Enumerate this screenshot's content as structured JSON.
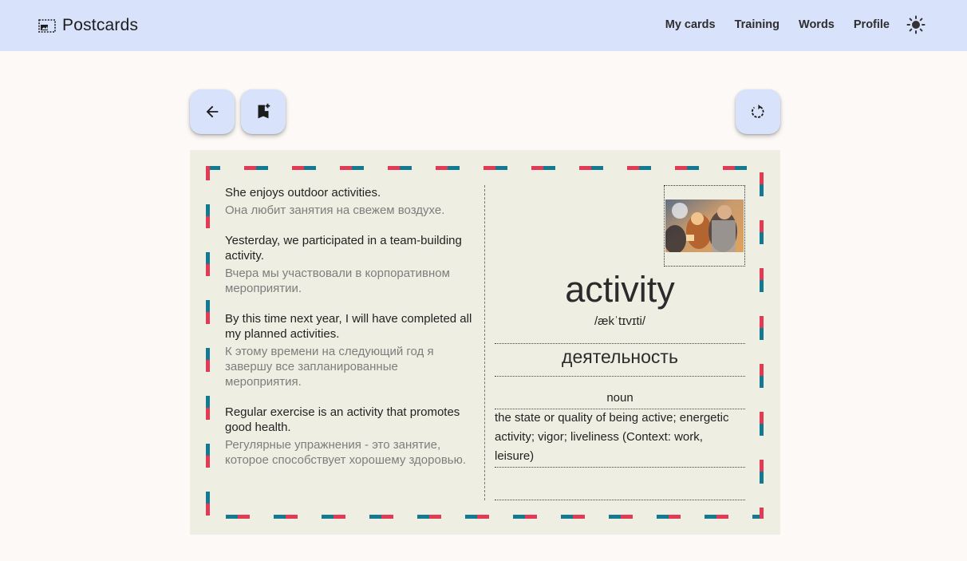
{
  "header": {
    "app_title": "Postcards",
    "app_icon": "postcard-icon",
    "nav": [
      {
        "label": "My cards"
      },
      {
        "label": "Training"
      },
      {
        "label": "Words"
      },
      {
        "label": "Profile"
      }
    ],
    "theme_icon": "sun-icon"
  },
  "toolbar": {
    "back_icon": "arrow-back-icon",
    "bookmark_icon": "bookmark-add-icon",
    "flip_icon": "rotate-icon"
  },
  "card": {
    "word": "activity",
    "transcription": "/ækˈtɪvɪti/",
    "translation": "деятельность",
    "part_of_speech": "noun",
    "definition": "the state or quality of being active; energetic activity; vigor; liveliness (Context: work, leisure)",
    "examples": [
      {
        "en": "She enjoys outdoor activities.",
        "ru": "Она любит занятия на свежем воздухе."
      },
      {
        "en": "Yesterday, we participated in a team-building activity.",
        "ru": "Вчера мы участвовали в корпоративном мероприятии."
      },
      {
        "en": "By this time next year, I will have completed all my planned activities.",
        "ru": "К этому времени на следующий год я завершу все запланированные мероприятия."
      },
      {
        "en": "Regular exercise is an activity that promotes good health.",
        "ru": "Регулярные упражнения - это занятие, которое способствует хорошему здоровью."
      }
    ]
  },
  "colors": {
    "header_bg": "#d9e2fb",
    "page_bg": "#fdf9f7",
    "card_bg": "#eeefe2",
    "airmail_red": "#e23a52",
    "airmail_teal": "#137a92"
  }
}
